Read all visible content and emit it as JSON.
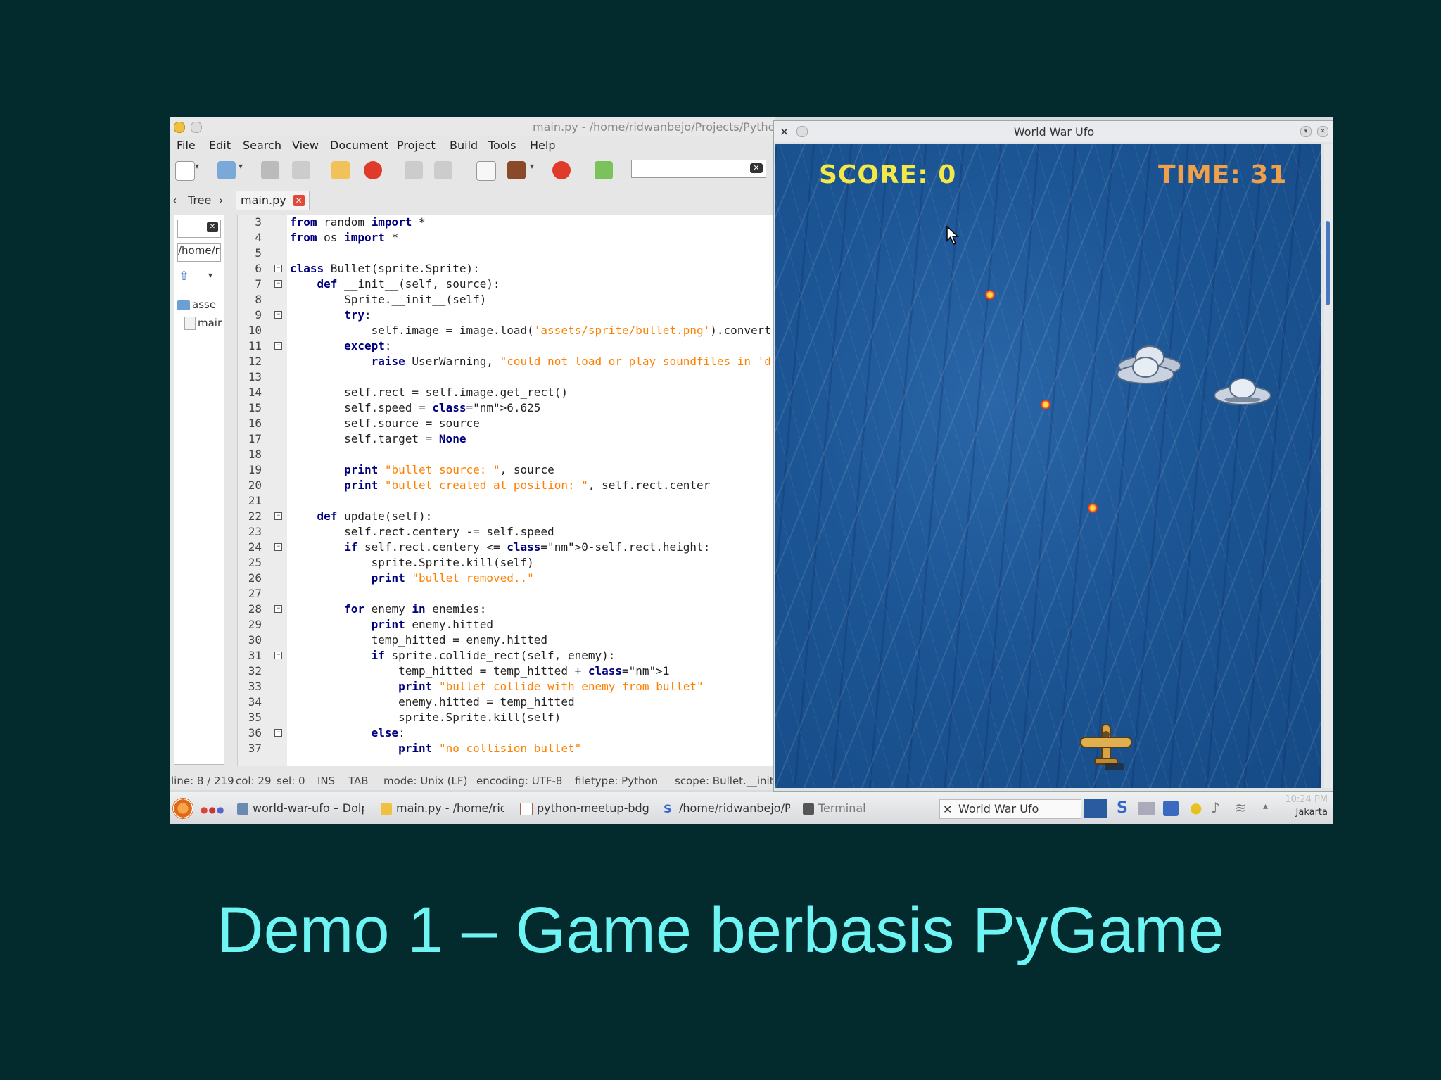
{
  "geany": {
    "title": "main.py - /home/ridwanbejo/Projects/Python F",
    "menu": [
      "File",
      "Edit",
      "Search",
      "View",
      "Document",
      "Project",
      "Build",
      "Tools",
      "Help"
    ],
    "side_tab": "Tree",
    "sidebar_path": "/home/ri",
    "tree_items": [
      "asse",
      "mair"
    ],
    "file_tab": "main.py",
    "code_lines": [
      {
        "n": "3",
        "t": "from random import *"
      },
      {
        "n": "4",
        "t": "from os import *"
      },
      {
        "n": "5",
        "t": ""
      },
      {
        "n": "6",
        "t": "class Bullet(sprite.Sprite):"
      },
      {
        "n": "7",
        "t": "    def __init__(self, source):"
      },
      {
        "n": "8",
        "t": "        Sprite.__init__(self)"
      },
      {
        "n": "9",
        "t": "        try:"
      },
      {
        "n": "10",
        "t": "            self.image = image.load('assets/sprite/bullet.png').convert"
      },
      {
        "n": "11",
        "t": "        except:"
      },
      {
        "n": "12",
        "t": "            raise UserWarning, \"could not load or play soundfiles in 'd"
      },
      {
        "n": "13",
        "t": ""
      },
      {
        "n": "14",
        "t": "        self.rect = self.image.get_rect()"
      },
      {
        "n": "15",
        "t": "        self.speed = 6.625"
      },
      {
        "n": "16",
        "t": "        self.source = source"
      },
      {
        "n": "17",
        "t": "        self.target = None"
      },
      {
        "n": "18",
        "t": ""
      },
      {
        "n": "19",
        "t": "        print \"bullet source: \", source"
      },
      {
        "n": "20",
        "t": "        print \"bullet created at position: \", self.rect.center"
      },
      {
        "n": "21",
        "t": ""
      },
      {
        "n": "22",
        "t": "    def update(self):"
      },
      {
        "n": "23",
        "t": "        self.rect.centery -= self.speed"
      },
      {
        "n": "24",
        "t": "        if self.rect.centery <= 0-self.rect.height:"
      },
      {
        "n": "25",
        "t": "            sprite.Sprite.kill(self)"
      },
      {
        "n": "26",
        "t": "            print \"bullet removed..\""
      },
      {
        "n": "27",
        "t": ""
      },
      {
        "n": "28",
        "t": "        for enemy in enemies:"
      },
      {
        "n": "29",
        "t": "            print enemy.hitted"
      },
      {
        "n": "30",
        "t": "            temp_hitted = enemy.hitted"
      },
      {
        "n": "31",
        "t": "            if sprite.collide_rect(self, enemy):"
      },
      {
        "n": "32",
        "t": "                temp_hitted = temp_hitted + 1"
      },
      {
        "n": "33",
        "t": "                print \"bullet collide with enemy from bullet\""
      },
      {
        "n": "34",
        "t": "                enemy.hitted = temp_hitted"
      },
      {
        "n": "35",
        "t": "                sprite.Sprite.kill(self)"
      },
      {
        "n": "36",
        "t": "            else:"
      },
      {
        "n": "37",
        "t": "                print \"no collision bullet\""
      }
    ],
    "status": {
      "line": "line: 8 / 219",
      "col": "col: 29",
      "sel": "sel: 0",
      "ins": "INS",
      "tab": "TAB",
      "mode": "mode: Unix (LF)",
      "encoding": "encoding: UTF-8",
      "filetype": "filetype: Python",
      "scope": "scope: Bullet.__init"
    }
  },
  "game": {
    "title": "World War Ufo",
    "score": "SCORE: 0",
    "time": "TIME: 31"
  },
  "taskbar": {
    "items": [
      "world-war-ufo – Dolp",
      "main.py - /home/ridw",
      "python-meetup-bdg",
      "/home/ridwanbejo/P",
      "Terminal",
      "World War Ufo"
    ],
    "clock_time": "10:24 PM",
    "clock_place": "Jakarta"
  },
  "caption": "Demo 1 – Game berbasis PyGame"
}
